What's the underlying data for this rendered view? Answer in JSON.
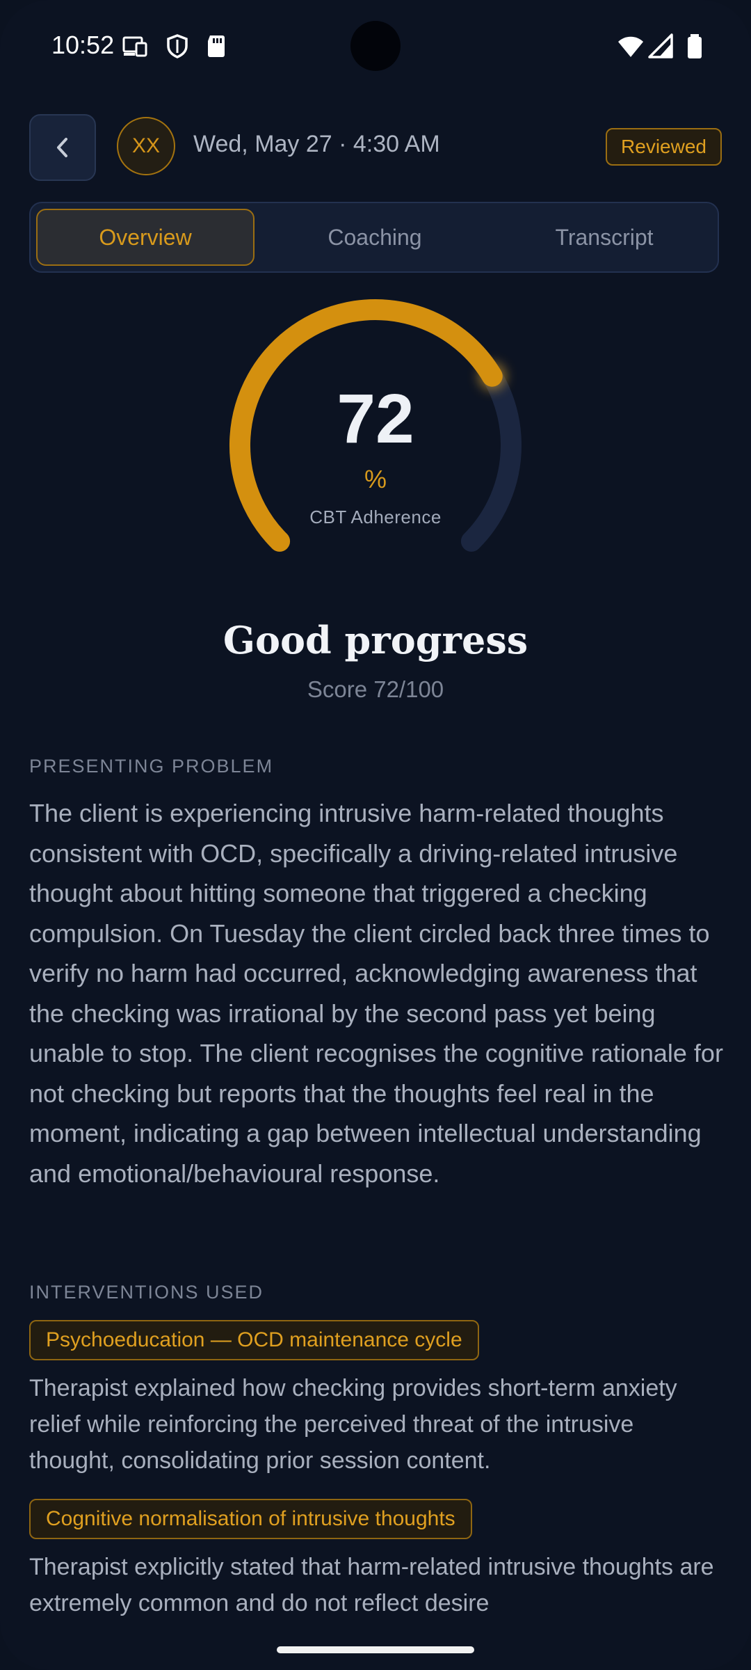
{
  "status_bar": {
    "time": "10:52"
  },
  "header": {
    "avatar_initials": "XX",
    "session_date": "Wed, May 27 · 4:30 AM",
    "badge": "Reviewed"
  },
  "tabs": [
    {
      "label": "Overview",
      "active": true
    },
    {
      "label": "Coaching",
      "active": false
    },
    {
      "label": "Transcript",
      "active": false
    }
  ],
  "gauge": {
    "value": 72,
    "unit": "%",
    "caption": "CBT Adherence",
    "fill_fraction": 0.72,
    "colors": {
      "fill": "#d4900f",
      "track": "#1b2640"
    }
  },
  "summary": {
    "verdict": "Good progress",
    "score_line": "Score 72/100"
  },
  "presenting_problem": {
    "label": "PRESENTING PROBLEM",
    "text": "The client is experiencing intrusive harm-related thoughts consistent with OCD, specifically a driving-related intrusive thought about hitting someone that triggered a checking compulsion. On Tuesday the client circled back three times to verify no harm had occurred, acknowledging awareness that the checking was irrational by the second pass yet being unable to stop. The client recognises the cognitive rationale for not checking but reports that the thoughts feel real in the moment, indicating a gap between intellectual understanding and emotional/behavioural response."
  },
  "interventions": {
    "label": "INTERVENTIONS USED",
    "items": [
      {
        "title": "Psychoeducation — OCD maintenance cycle",
        "text": "Therapist explained how checking provides short-term anxiety relief while reinforcing the perceived threat of the intrusive thought, consolidating prior session content."
      },
      {
        "title": "Cognitive normalisation of intrusive thoughts",
        "text": "Therapist explicitly stated that harm-related intrusive thoughts are extremely common and do not reflect desire"
      }
    ]
  },
  "theme": {
    "accent": "#d89a1c",
    "background": "#0c1322"
  }
}
